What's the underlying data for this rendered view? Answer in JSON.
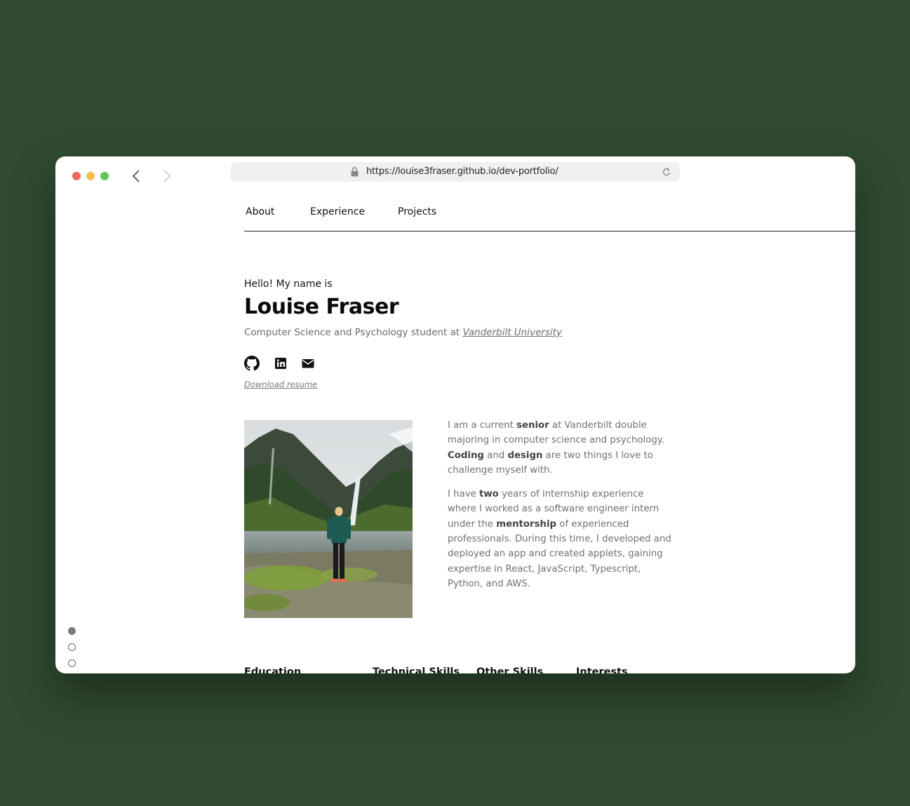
{
  "browser": {
    "url": "https://louise3fraser.github.io/dev-portfolio/",
    "icons": [
      "lock-icon",
      "reload-icon",
      "back-arrow-icon",
      "forward-arrow-icon"
    ]
  },
  "nav": {
    "items": [
      {
        "label": "About"
      },
      {
        "label": "Experience"
      },
      {
        "label": "Projects"
      }
    ]
  },
  "hero": {
    "greeting": "Hello! My name is",
    "name": "Louise Fraser",
    "subtitle_prefix": "Computer Science and Psychology student at",
    "university": "Vanderbilt University",
    "social_icons": [
      "github-icon",
      "linkedin-icon",
      "email-icon"
    ],
    "resume_link": "Download resume"
  },
  "about": {
    "p1": {
      "t1": "I am a current ",
      "b1": "senior",
      "t2": " at Vanderbilt double majoring in computer science and psychology. ",
      "b2": "Coding",
      "t3": " and ",
      "b3": "design",
      "t4": " are two things I love to challenge myself with."
    },
    "p2": {
      "t1": "I have ",
      "b1": "two",
      "t2": " years of internship experience where I worked as a software engineer intern under the ",
      "b2": "mentorship",
      "t3": " of experienced professionals. During this time, I developed and deployed an app and created applets, gaining expertise in React, JavaScript, Typescript, Python, and AWS."
    }
  },
  "sections": {
    "education": "Education",
    "technical_skills": "Technical Skills",
    "other_skills": "Other Skills",
    "interests": "Interests"
  },
  "colors": {
    "background": "#2f4a2f",
    "text": "#111111",
    "muted": "#707070"
  }
}
